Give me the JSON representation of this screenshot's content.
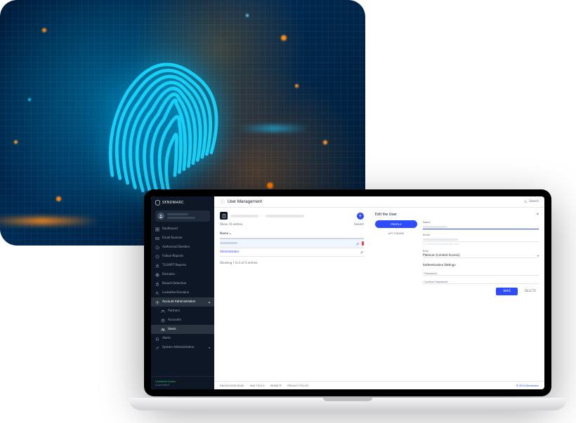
{
  "decorative": {
    "alt": "fingerprint-circuit-illustration"
  },
  "brand": {
    "name": "SENDMARC"
  },
  "sidebar": {
    "items": [
      {
        "label": "Dashboard",
        "icon": "dashboard"
      },
      {
        "label": "Email Sources",
        "icon": "envelope"
      },
      {
        "label": "Authorised Senders",
        "icon": "check-badge"
      },
      {
        "label": "Failure Reports",
        "icon": "exclaim"
      },
      {
        "label": "TLS-RPT Reports",
        "icon": "lock"
      },
      {
        "label": "Domains",
        "icon": "globe"
      },
      {
        "label": "Breach Detection",
        "icon": "lock"
      },
      {
        "label": "Lookalike Domains",
        "icon": "search"
      },
      {
        "label": "Account Administration",
        "icon": "cog",
        "expandable": true,
        "active": true
      },
      {
        "label": "Partners",
        "icon": "partners",
        "sub": true
      },
      {
        "label": "Accounts",
        "icon": "accounts",
        "sub": true
      },
      {
        "label": "Users",
        "icon": "users",
        "sub": true,
        "selected": true
      },
      {
        "label": "Alerts",
        "icon": "bell"
      },
      {
        "label": "System Administration",
        "icon": "tool",
        "expandable": true
      }
    ],
    "footer": {
      "plan": "Unlimited Quota",
      "sub": "Automated"
    }
  },
  "header": {
    "title": "User Management",
    "search_placeholder": "Search"
  },
  "left": {
    "show_prefix": "Show",
    "show_count": "10",
    "show_suffix": "entries",
    "search_label": "Search",
    "col1": "Name",
    "rows": [
      {
        "name_redacted": true
      },
      {
        "name": "Administrator"
      }
    ],
    "info": "Showing 1 to 2 of 2 entries"
  },
  "right": {
    "title": "Edit the User",
    "tabs": [
      {
        "label": "PROFILE",
        "active": true
      },
      {
        "label": "API TOKENS",
        "active": false
      }
    ],
    "fields": {
      "name_label": "Name",
      "email_label": "Email",
      "email_hint": "e.g. name@exampledomain.com",
      "role_label": "Role",
      "role_value": "Platinum (Limited Access)",
      "auth_section": "Authentication Settings",
      "password_label": "Password",
      "confirm_label": "Confirm Password"
    },
    "actions": {
      "save": "SAVE",
      "delete": "DELETE"
    }
  },
  "footer": {
    "links": [
      "KNOWLEDGE BASE",
      "DNS TOOLS",
      "WEBSITE",
      "PRIVACY POLICY"
    ],
    "copyright": "© 2024 Sendmarc"
  }
}
